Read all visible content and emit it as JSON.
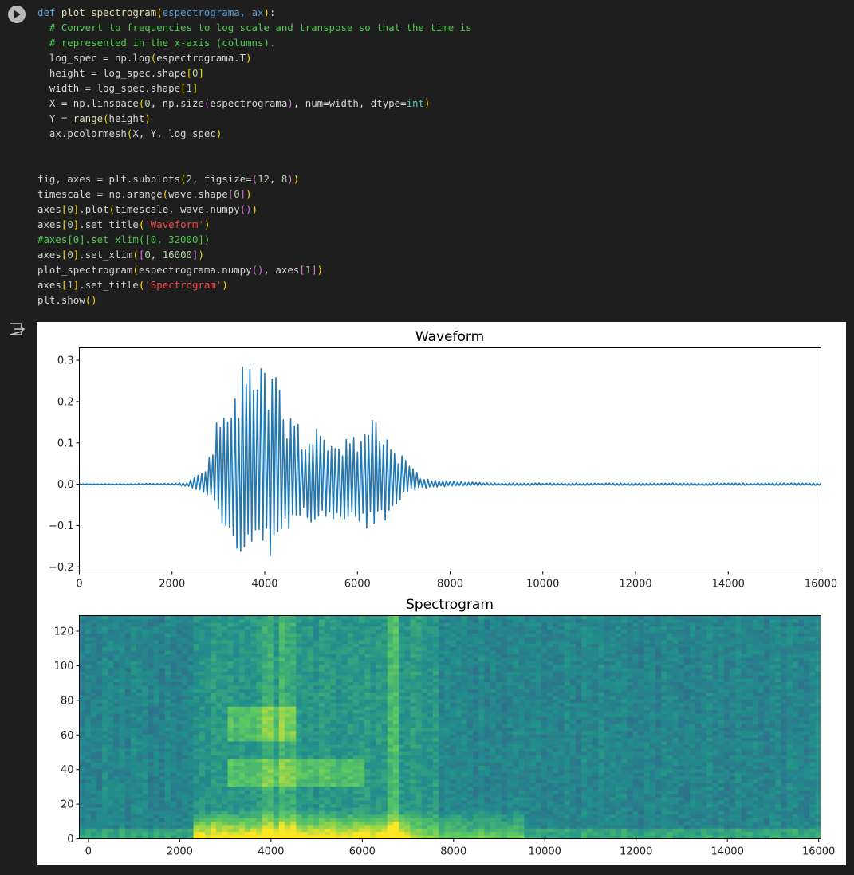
{
  "code": {
    "lines": [
      [
        [
          "def ",
          "kw"
        ],
        [
          "plot_spectrogram",
          "fn"
        ],
        [
          "(",
          "br1"
        ],
        [
          "espectrograma, ax",
          "kw"
        ],
        [
          ")",
          "br1"
        ],
        [
          ":",
          ""
        ]
      ],
      [
        [
          "  # Convert to frequencies to log scale and transpose so that the time is",
          "cmb"
        ]
      ],
      [
        [
          "  # represented in the x-axis (columns).",
          "cmb"
        ]
      ],
      [
        [
          "  log_spec = np.log",
          ""
        ],
        [
          "(",
          "br1"
        ],
        [
          "espectrograma.T",
          ""
        ],
        [
          ")",
          "br1"
        ]
      ],
      [
        [
          "  height = log_spec.shape",
          ""
        ],
        [
          "[",
          "br1"
        ],
        [
          "0",
          "num"
        ],
        [
          "]",
          "br1"
        ]
      ],
      [
        [
          "  width = log_spec.shape",
          ""
        ],
        [
          "[",
          "br1"
        ],
        [
          "1",
          "num"
        ],
        [
          "]",
          "br1"
        ]
      ],
      [
        [
          "  X = np.linspace",
          ""
        ],
        [
          "(",
          "br1"
        ],
        [
          "0",
          "num"
        ],
        [
          ", np.size",
          ""
        ],
        [
          "(",
          "br2"
        ],
        [
          "espectrograma",
          ""
        ],
        [
          ")",
          "br2"
        ],
        [
          ", num=width, dtype=",
          ""
        ],
        [
          "int",
          "bi"
        ],
        [
          ")",
          "br1"
        ]
      ],
      [
        [
          "  Y = ",
          ""
        ],
        [
          "range",
          "fn"
        ],
        [
          "(",
          "br1"
        ],
        [
          "height",
          ""
        ],
        [
          ")",
          "br1"
        ]
      ],
      [
        [
          "  ax.pcolormesh",
          ""
        ],
        [
          "(",
          "br1"
        ],
        [
          "X, Y, log_spec",
          ""
        ],
        [
          ")",
          "br1"
        ]
      ],
      [],
      [],
      [
        [
          "fig, axes = plt.subplots",
          ""
        ],
        [
          "(",
          "br1"
        ],
        [
          "2",
          "num"
        ],
        [
          ", figsize=",
          ""
        ],
        [
          "(",
          "br2"
        ],
        [
          "12",
          "num"
        ],
        [
          ", ",
          ""
        ],
        [
          "8",
          "num"
        ],
        [
          ")",
          "br2"
        ],
        [
          ")",
          "br1"
        ]
      ],
      [
        [
          "timescale = np.arange",
          ""
        ],
        [
          "(",
          "br1"
        ],
        [
          "wave.shape",
          ""
        ],
        [
          "[",
          "br2"
        ],
        [
          "0",
          "num"
        ],
        [
          "]",
          "br2"
        ],
        [
          ")",
          "br1"
        ]
      ],
      [
        [
          "axes",
          ""
        ],
        [
          "[",
          "br1"
        ],
        [
          "0",
          "num"
        ],
        [
          "]",
          "br1"
        ],
        [
          ".plot",
          ""
        ],
        [
          "(",
          "br1"
        ],
        [
          "timescale, wave.numpy",
          ""
        ],
        [
          "()",
          "br2"
        ],
        [
          ")",
          "br1"
        ]
      ],
      [
        [
          "axes",
          ""
        ],
        [
          "[",
          "br1"
        ],
        [
          "0",
          "num"
        ],
        [
          "]",
          "br1"
        ],
        [
          ".set_title",
          ""
        ],
        [
          "(",
          "br1"
        ],
        [
          "'Waveform'",
          "str"
        ],
        [
          ")",
          "br1"
        ]
      ],
      [
        [
          "#axes[0].set_xlim([0, 32000])",
          "cmb"
        ]
      ],
      [
        [
          "axes",
          ""
        ],
        [
          "[",
          "br1"
        ],
        [
          "0",
          "num"
        ],
        [
          "]",
          "br1"
        ],
        [
          ".set_xlim",
          ""
        ],
        [
          "(",
          "br1"
        ],
        [
          "[",
          "br2"
        ],
        [
          "0",
          "num"
        ],
        [
          ", ",
          ""
        ],
        [
          "16000",
          "num"
        ],
        [
          "]",
          "br2"
        ],
        [
          ")",
          "br1"
        ]
      ],
      [
        [
          "plot_spectrogram",
          ""
        ],
        [
          "(",
          "br1"
        ],
        [
          "espectrograma.numpy",
          ""
        ],
        [
          "()",
          "br2"
        ],
        [
          ", axes",
          ""
        ],
        [
          "[",
          "br2"
        ],
        [
          "1",
          "num"
        ],
        [
          "]",
          "br2"
        ],
        [
          ")",
          "br1"
        ]
      ],
      [
        [
          "axes",
          ""
        ],
        [
          "[",
          "br1"
        ],
        [
          "1",
          "num"
        ],
        [
          "]",
          "br1"
        ],
        [
          ".set_title",
          ""
        ],
        [
          "(",
          "br1"
        ],
        [
          "'Spectrogram'",
          "str"
        ],
        [
          ")",
          "br1"
        ]
      ],
      [
        [
          "plt.show",
          ""
        ],
        [
          "()",
          "br1"
        ]
      ]
    ]
  },
  "chart_data": [
    {
      "type": "line",
      "title": "Waveform",
      "xlabel": "",
      "ylabel": "",
      "xlim": [
        0,
        16000
      ],
      "ylim": [
        -0.21,
        0.33
      ],
      "xticks": [
        0,
        2000,
        4000,
        6000,
        8000,
        10000,
        12000,
        14000,
        16000
      ],
      "yticks": [
        -0.2,
        -0.1,
        0.0,
        0.1,
        0.2,
        0.3
      ],
      "ytick_labels": [
        "−0.2",
        "−0.1",
        "0.0",
        "0.1",
        "0.2",
        "0.3"
      ],
      "grid": false,
      "line_color": "#1f77b4",
      "envelope": {
        "x": [
          0,
          2000,
          2350,
          2500,
          2700,
          2850,
          3000,
          3200,
          3400,
          3600,
          3800,
          4000,
          4200,
          4400,
          4600,
          4800,
          5000,
          5200,
          5400,
          5600,
          5800,
          6000,
          6200,
          6400,
          6600,
          6800,
          7000,
          7200,
          7400,
          7600,
          7800,
          8000,
          8400,
          8800,
          9000,
          10000,
          12000,
          14000,
          16000
        ],
        "pos": [
          0.001,
          0.002,
          0.005,
          0.02,
          0.03,
          0.11,
          0.18,
          0.25,
          0.26,
          0.3,
          0.29,
          0.28,
          0.3,
          0.2,
          0.16,
          0.15,
          0.14,
          0.13,
          0.12,
          0.11,
          0.12,
          0.13,
          0.16,
          0.17,
          0.13,
          0.1,
          0.07,
          0.04,
          0.015,
          0.012,
          0.01,
          0.008,
          0.006,
          0.004,
          0.003,
          0.003,
          0.003,
          0.003,
          0.003
        ],
        "neg": [
          0.001,
          0.002,
          0.005,
          0.015,
          0.02,
          0.04,
          0.1,
          0.14,
          0.16,
          0.17,
          0.16,
          0.17,
          0.18,
          0.13,
          0.11,
          0.1,
          0.1,
          0.1,
          0.1,
          0.1,
          0.1,
          0.11,
          0.11,
          0.1,
          0.09,
          0.06,
          0.03,
          0.015,
          0.01,
          0.008,
          0.006,
          0.005,
          0.004,
          0.003,
          0.003,
          0.003,
          0.003,
          0.003,
          0.003
        ]
      }
    },
    {
      "type": "heatmap",
      "title": "Spectrogram",
      "xlabel": "",
      "ylabel": "",
      "xlim": [
        -200,
        16050
      ],
      "ylim": [
        0,
        129
      ],
      "xticks": [
        0,
        2000,
        4000,
        6000,
        8000,
        10000,
        12000,
        14000,
        16000
      ],
      "yticks": [
        0,
        20,
        40,
        60,
        80,
        100,
        120
      ],
      "colormap": "viridis",
      "colorscale": [
        "#440154",
        "#3b528b",
        "#21918c",
        "#5ec962",
        "#fde725"
      ],
      "features": [
        {
          "kind": "low-band",
          "x_range": [
            2200,
            9500
          ],
          "y_range": [
            0,
            15
          ],
          "intensity": "high"
        },
        {
          "kind": "formant",
          "x_range": [
            3000,
            6000
          ],
          "y_range": [
            30,
            45
          ],
          "intensity": "medium"
        },
        {
          "kind": "formant",
          "x_range": [
            3000,
            4500
          ],
          "y_range": [
            55,
            75
          ],
          "intensity": "medium"
        },
        {
          "kind": "vertical-burst",
          "x": 6600,
          "y_range": [
            0,
            128
          ],
          "intensity": "high"
        },
        {
          "kind": "vertical-burst",
          "x": 3900,
          "y_range": [
            0,
            128
          ],
          "intensity": "medium"
        },
        {
          "kind": "vertical-burst",
          "x": 4300,
          "y_range": [
            0,
            128
          ],
          "intensity": "medium"
        }
      ]
    }
  ],
  "icons": {
    "run": "play-circle-icon",
    "output": "output-exit-icon"
  }
}
